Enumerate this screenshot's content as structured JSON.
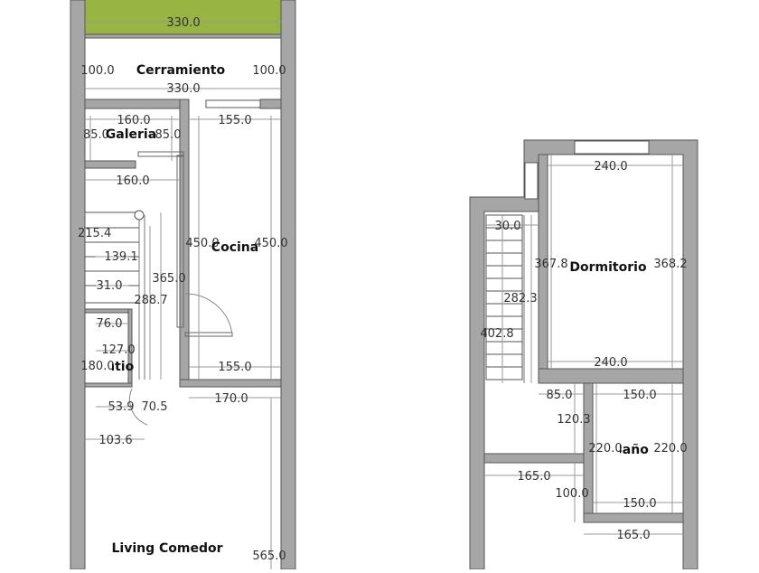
{
  "plan": {
    "colors": {
      "wall": "#a6a6a6",
      "wall_edge": "#555555",
      "grass": "#9cb845",
      "dimension_line": "#9a9a9a",
      "window": "#ffffff"
    },
    "ground_floor": {
      "rooms": {
        "cerramiento": "Cerramiento",
        "galeria": "Galeria",
        "cocina": "Cocina",
        "patio": "Patio",
        "living_comedor": "Living Comedor"
      },
      "dims": {
        "garden_width": "330.0",
        "cerr_left": "100.0",
        "cerr_right": "100.0",
        "cerr_width": "330.0",
        "galeria_width": "160.0",
        "galeria_left": "85.0",
        "galeria_right": "85.0",
        "kitchen_top": "155.0",
        "stair_top": "160.0",
        "stair_215": "215.4",
        "stair_139": "139.1",
        "stair_31": "31.0",
        "stair_365": "365.0",
        "stair_288": "288.7",
        "kitchen_left": "450.0",
        "kitchen_right": "450.0",
        "patio_76": "76.0",
        "patio_127": "127.0",
        "patio_180": "180.0",
        "kitchen_bottom": "155.0",
        "living_top": "170.0",
        "door_53": "53.9",
        "door_70": "70.5",
        "living_103": "103.6",
        "living_height": "565.0"
      }
    },
    "upper_floor": {
      "rooms": {
        "dormitorio": "Dormitorio",
        "bano": "Baño"
      },
      "dims": {
        "dorm_top": "240.0",
        "stair_30": "30.0",
        "dorm_left": "367.8",
        "dorm_right": "368.2",
        "stair_282": "282.3",
        "stair_402": "402.8",
        "dorm_bottom": "240.0",
        "hall_85": "85.0",
        "bath_top": "150.0",
        "hall_120": "120.3",
        "bath_left": "220.0",
        "bath_right": "220.0",
        "lower_165": "165.0",
        "lower_100": "100.0",
        "bath_bottom": "150.0",
        "bottom_165": "165.0"
      }
    }
  }
}
